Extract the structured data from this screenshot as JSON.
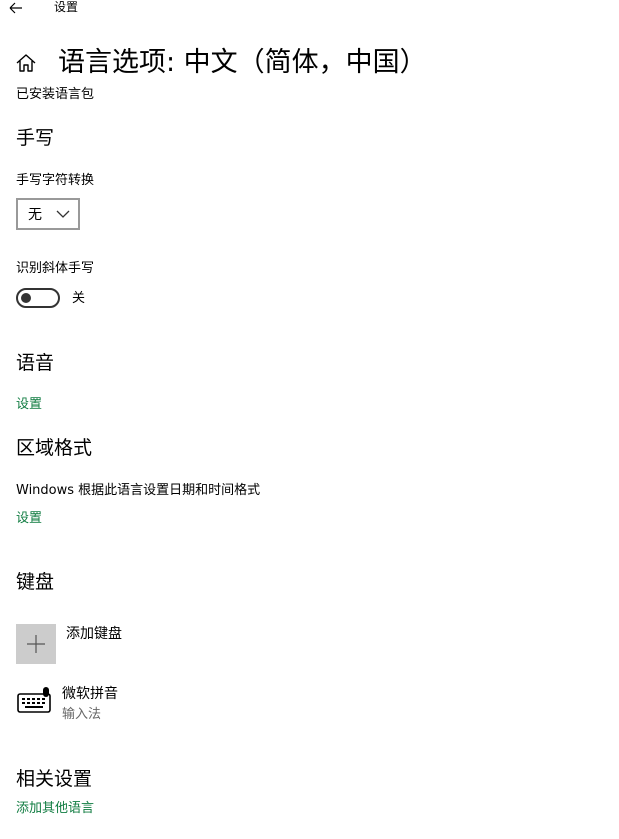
{
  "app": {
    "title": "设置"
  },
  "page": {
    "title": "语言选项: 中文（简体，中国）",
    "installed_text": "已安装语言包"
  },
  "handwriting": {
    "heading": "手写",
    "conversion_label": "手写字符转换",
    "conversion_value": "无",
    "italic_label": "识别斜体手写",
    "italic_toggle_state": "关"
  },
  "speech": {
    "heading": "语音",
    "settings_link": "设置"
  },
  "region": {
    "heading": "区域格式",
    "description": "Windows 根据此语言设置日期和时间格式",
    "settings_link": "设置"
  },
  "keyboard": {
    "heading": "键盘",
    "add_label": "添加键盘",
    "items": [
      {
        "name": "微软拼音",
        "type": "输入法"
      }
    ]
  },
  "related": {
    "heading": "相关设置",
    "add_language_link": "添加其他语言"
  },
  "colors": {
    "link": "#107c41",
    "tile": "#cccccc"
  },
  "icons": {
    "back": "arrow-left-icon",
    "home": "home-icon",
    "chevron": "chevron-down-icon",
    "add": "plus-icon",
    "keyboard": "keyboard-icon"
  }
}
